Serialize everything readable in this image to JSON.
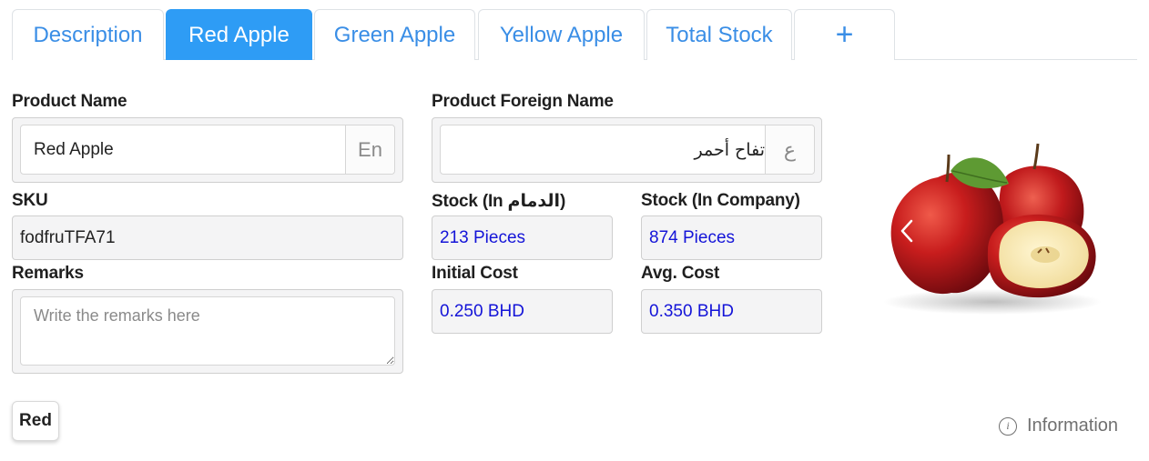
{
  "tabs": [
    {
      "label": "Description",
      "active": false
    },
    {
      "label": "Red Apple",
      "active": true
    },
    {
      "label": "Green Apple",
      "active": false
    },
    {
      "label": "Yellow Apple",
      "active": false
    },
    {
      "label": "Total Stock",
      "active": false
    },
    {
      "label": "+",
      "active": false
    }
  ],
  "product_name": {
    "label": "Product Name",
    "value": "Red Apple",
    "addon": "En"
  },
  "foreign_name": {
    "label": "Product Foreign Name",
    "value": "تفاح أحمر",
    "addon": "ع"
  },
  "sku": {
    "label": "SKU",
    "value": "fodfruTFA71"
  },
  "stock_branch": {
    "label": "Stock (In الدمام)",
    "value": "213 Pieces"
  },
  "stock_company": {
    "label": "Stock (In Company)",
    "value": "874 Pieces"
  },
  "remarks": {
    "label": "Remarks",
    "placeholder": "Write the remarks here",
    "value": ""
  },
  "initial_cost": {
    "label": "Initial Cost",
    "value": "0.250 BHD"
  },
  "avg_cost": {
    "label": "Avg. Cost",
    "value": "0.350 BHD"
  },
  "color_button": {
    "label": "Red"
  },
  "info_link": {
    "label": "Information",
    "icon": "info-icon"
  },
  "carousel": {
    "prev_icon": "chevron-left-icon",
    "image": "red-apples"
  },
  "colors": {
    "accent": "#2e9cf5",
    "tab_text": "#3a8ee6",
    "value_blue": "#1414d8"
  }
}
